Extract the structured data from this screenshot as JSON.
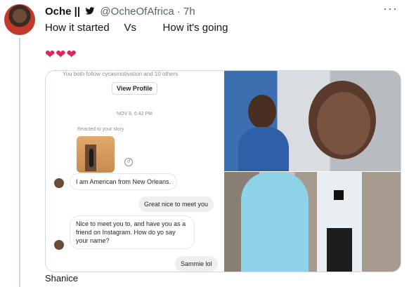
{
  "tweet": {
    "name": "Oche ||",
    "handle": "@OcheOfAfrica",
    "separator": "·",
    "time": "7h",
    "text": "How it started     Vs         How it's going",
    "hearts": "❤❤❤",
    "more": "···"
  },
  "chat": {
    "top_text": "You both follow cycasmotivation and 10 others",
    "view_profile": "View Profile",
    "date": "NOV 8, 6:42 PM",
    "reacted": "Reacted to your story",
    "messages": [
      {
        "side": "in",
        "text": "I am American from New Orleans."
      },
      {
        "side": "out",
        "text": "Great nice to meet you"
      },
      {
        "side": "in",
        "text": "Nice to meet you to, and have you as a friend on Instagram. How do yo say your name?"
      },
      {
        "side": "out",
        "text": "Sammie lol"
      }
    ]
  },
  "next_tweet": {
    "text": "Shanice"
  },
  "colors": {
    "heart": "#e0245e",
    "handle": "#536471",
    "bird": "#0f1419"
  },
  "icons": [
    "twitter-bird-icon",
    "more-icon",
    "reply-icon"
  ]
}
